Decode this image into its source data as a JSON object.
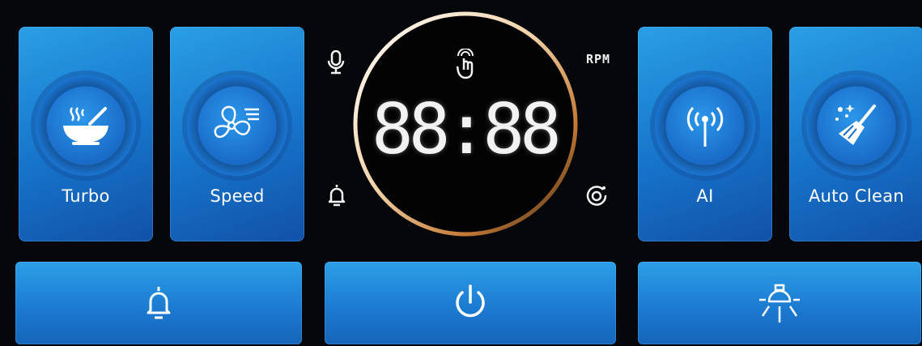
{
  "modes": {
    "turbo": {
      "label": "Turbo",
      "icon": "cooking-pot-icon"
    },
    "speed": {
      "label": "Speed",
      "icon": "fan-speed-icon"
    },
    "ai": {
      "label": "AI",
      "icon": "wireless-antenna-icon"
    },
    "auto_clean": {
      "label": "Auto Clean",
      "icon": "broom-icon"
    }
  },
  "display": {
    "digits": "88:88",
    "unit": "RPM",
    "indicators": [
      "microphone-icon",
      "gesture-hand-icon",
      "bell-icon",
      "timer-icon"
    ]
  },
  "bottom_bar": {
    "left": "bell-icon",
    "center": "power-icon",
    "right": "light-icon"
  },
  "colors": {
    "background": "#05070b",
    "button_blue": "#1b78cf",
    "ring_glow": "#e9a45a",
    "display_white": "#f2f2f2"
  }
}
